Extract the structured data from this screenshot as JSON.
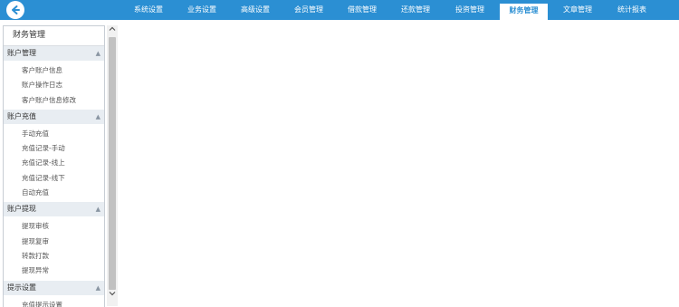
{
  "nav": {
    "items": [
      "系统设置",
      "业务设置",
      "高级设置",
      "会员管理",
      "借款管理",
      "还款管理",
      "投资管理",
      "财务管理",
      "文章管理",
      "统计报表"
    ],
    "active_index": 7,
    "accent": "#2b8fd3"
  },
  "sidebar": {
    "title": "财务管理",
    "groups": [
      {
        "header": "账户管理",
        "items": [
          "客户账户信息",
          "账户操作日志",
          "客户账户信息修改"
        ]
      },
      {
        "header": "账户充值",
        "items": [
          "手动充值",
          "充值记录-手动",
          "充值记录-线上",
          "充值记录-线下",
          "自动充值"
        ]
      },
      {
        "header": "账户提现",
        "items": [
          "提现审核",
          "提现复审",
          "转款打款",
          "提现异常"
        ]
      },
      {
        "header": "提示设置",
        "items": [
          "充值提示设置"
        ]
      }
    ]
  },
  "icons": {
    "back": "back-arrow-icon",
    "collapse": "chevron-up-icon"
  }
}
